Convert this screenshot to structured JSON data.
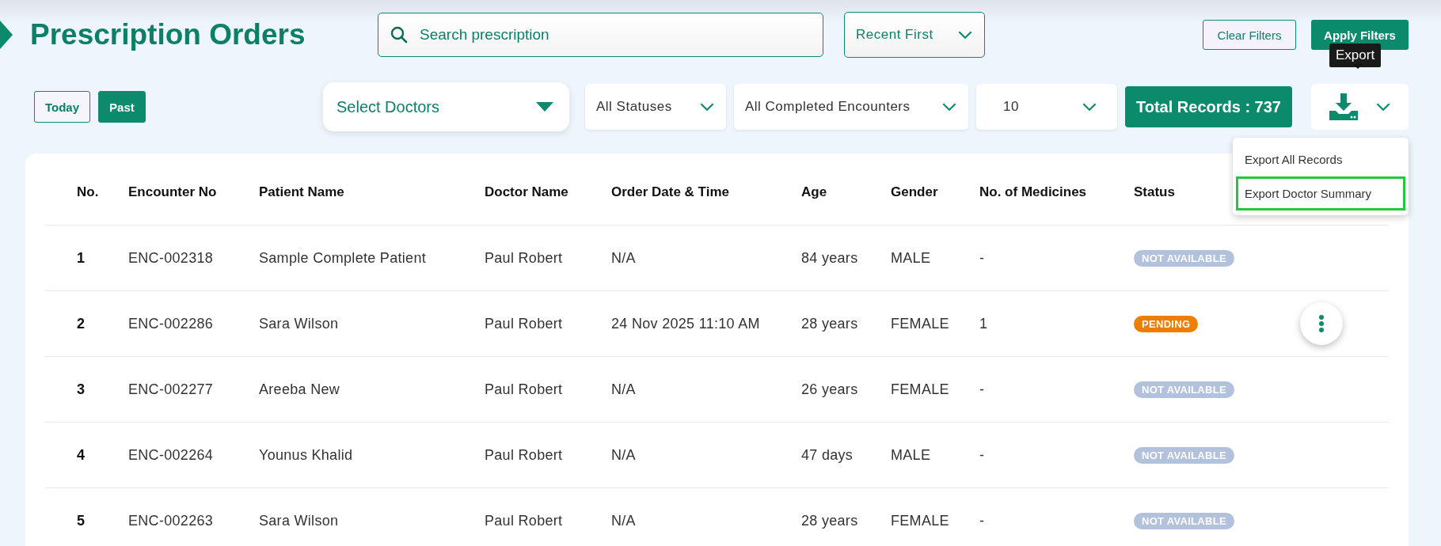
{
  "title": "Prescription Orders",
  "search": {
    "placeholder": "Search prescription"
  },
  "sort": {
    "value": "Recent First"
  },
  "buttons": {
    "clear": "Clear Filters",
    "apply": "Apply Filters"
  },
  "tooltip": "Export",
  "period_tabs": [
    {
      "label": "Today",
      "selected": false
    },
    {
      "label": "Past",
      "selected": true
    }
  ],
  "filters": {
    "doctors": "Select Doctors",
    "status": "All Statuses",
    "encounters": "All Completed Encounters",
    "page_size": "10"
  },
  "total_records": "Total Records : 737",
  "export_menu": [
    {
      "label": "Export All Records",
      "selected": false
    },
    {
      "label": "Export Doctor Summary",
      "selected": true
    }
  ],
  "table": {
    "columns": [
      "No.",
      "Encounter No",
      "Patient Name",
      "Doctor Name",
      "Order Date & Time",
      "Age",
      "Gender",
      "No. of Medicines",
      "Status"
    ],
    "rows": [
      {
        "cells": [
          "1",
          "ENC-002318",
          "Sample Complete Patient",
          "Paul Robert",
          "N/A",
          "84 years",
          "MALE",
          "-"
        ],
        "status": {
          "label": "NOT AVAILABLE",
          "kind": "not_available"
        },
        "has_actions": false
      },
      {
        "cells": [
          "2",
          "ENC-002286",
          "Sara Wilson",
          "Paul Robert",
          "24 Nov 2025 11:10 AM",
          "28 years",
          "FEMALE",
          "1"
        ],
        "status": {
          "label": "PENDING",
          "kind": "pending"
        },
        "has_actions": true
      },
      {
        "cells": [
          "3",
          "ENC-002277",
          "Areeba New",
          "Paul Robert",
          "N/A",
          "26 years",
          "FEMALE",
          "-"
        ],
        "status": {
          "label": "NOT AVAILABLE",
          "kind": "not_available"
        },
        "has_actions": false
      },
      {
        "cells": [
          "4",
          "ENC-002264",
          "Younus Khalid",
          "Paul Robert",
          "N/A",
          "47 days",
          "MALE",
          "-"
        ],
        "status": {
          "label": "NOT AVAILABLE",
          "kind": "not_available"
        },
        "has_actions": false
      },
      {
        "cells": [
          "5",
          "ENC-002263",
          "Sara Wilson",
          "Paul Robert",
          "N/A",
          "28 years",
          "FEMALE",
          "-"
        ],
        "status": {
          "label": "NOT AVAILABLE",
          "kind": "not_available"
        },
        "has_actions": false
      }
    ]
  }
}
